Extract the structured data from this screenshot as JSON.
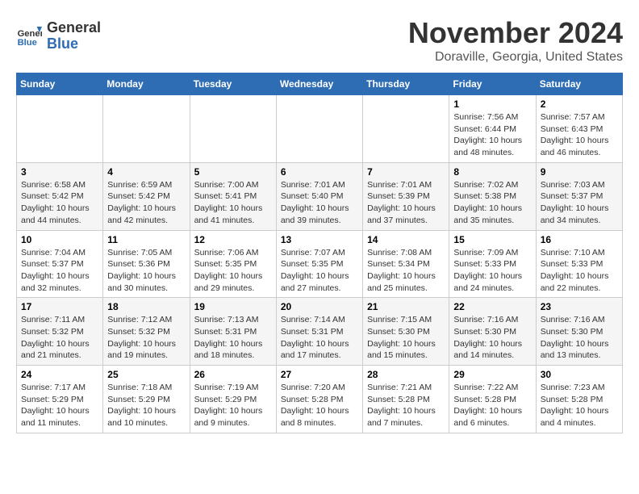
{
  "logo": {
    "general": "General",
    "blue": "Blue"
  },
  "header": {
    "month_title": "November 2024",
    "location": "Doraville, Georgia, United States"
  },
  "weekdays": [
    "Sunday",
    "Monday",
    "Tuesday",
    "Wednesday",
    "Thursday",
    "Friday",
    "Saturday"
  ],
  "weeks": [
    [
      {
        "day": "",
        "info": ""
      },
      {
        "day": "",
        "info": ""
      },
      {
        "day": "",
        "info": ""
      },
      {
        "day": "",
        "info": ""
      },
      {
        "day": "",
        "info": ""
      },
      {
        "day": "1",
        "info": "Sunrise: 7:56 AM\nSunset: 6:44 PM\nDaylight: 10 hours and 48 minutes."
      },
      {
        "day": "2",
        "info": "Sunrise: 7:57 AM\nSunset: 6:43 PM\nDaylight: 10 hours and 46 minutes."
      }
    ],
    [
      {
        "day": "3",
        "info": "Sunrise: 6:58 AM\nSunset: 5:42 PM\nDaylight: 10 hours and 44 minutes."
      },
      {
        "day": "4",
        "info": "Sunrise: 6:59 AM\nSunset: 5:42 PM\nDaylight: 10 hours and 42 minutes."
      },
      {
        "day": "5",
        "info": "Sunrise: 7:00 AM\nSunset: 5:41 PM\nDaylight: 10 hours and 41 minutes."
      },
      {
        "day": "6",
        "info": "Sunrise: 7:01 AM\nSunset: 5:40 PM\nDaylight: 10 hours and 39 minutes."
      },
      {
        "day": "7",
        "info": "Sunrise: 7:01 AM\nSunset: 5:39 PM\nDaylight: 10 hours and 37 minutes."
      },
      {
        "day": "8",
        "info": "Sunrise: 7:02 AM\nSunset: 5:38 PM\nDaylight: 10 hours and 35 minutes."
      },
      {
        "day": "9",
        "info": "Sunrise: 7:03 AM\nSunset: 5:37 PM\nDaylight: 10 hours and 34 minutes."
      }
    ],
    [
      {
        "day": "10",
        "info": "Sunrise: 7:04 AM\nSunset: 5:37 PM\nDaylight: 10 hours and 32 minutes."
      },
      {
        "day": "11",
        "info": "Sunrise: 7:05 AM\nSunset: 5:36 PM\nDaylight: 10 hours and 30 minutes."
      },
      {
        "day": "12",
        "info": "Sunrise: 7:06 AM\nSunset: 5:35 PM\nDaylight: 10 hours and 29 minutes."
      },
      {
        "day": "13",
        "info": "Sunrise: 7:07 AM\nSunset: 5:35 PM\nDaylight: 10 hours and 27 minutes."
      },
      {
        "day": "14",
        "info": "Sunrise: 7:08 AM\nSunset: 5:34 PM\nDaylight: 10 hours and 25 minutes."
      },
      {
        "day": "15",
        "info": "Sunrise: 7:09 AM\nSunset: 5:33 PM\nDaylight: 10 hours and 24 minutes."
      },
      {
        "day": "16",
        "info": "Sunrise: 7:10 AM\nSunset: 5:33 PM\nDaylight: 10 hours and 22 minutes."
      }
    ],
    [
      {
        "day": "17",
        "info": "Sunrise: 7:11 AM\nSunset: 5:32 PM\nDaylight: 10 hours and 21 minutes."
      },
      {
        "day": "18",
        "info": "Sunrise: 7:12 AM\nSunset: 5:32 PM\nDaylight: 10 hours and 19 minutes."
      },
      {
        "day": "19",
        "info": "Sunrise: 7:13 AM\nSunset: 5:31 PM\nDaylight: 10 hours and 18 minutes."
      },
      {
        "day": "20",
        "info": "Sunrise: 7:14 AM\nSunset: 5:31 PM\nDaylight: 10 hours and 17 minutes."
      },
      {
        "day": "21",
        "info": "Sunrise: 7:15 AM\nSunset: 5:30 PM\nDaylight: 10 hours and 15 minutes."
      },
      {
        "day": "22",
        "info": "Sunrise: 7:16 AM\nSunset: 5:30 PM\nDaylight: 10 hours and 14 minutes."
      },
      {
        "day": "23",
        "info": "Sunrise: 7:16 AM\nSunset: 5:30 PM\nDaylight: 10 hours and 13 minutes."
      }
    ],
    [
      {
        "day": "24",
        "info": "Sunrise: 7:17 AM\nSunset: 5:29 PM\nDaylight: 10 hours and 11 minutes."
      },
      {
        "day": "25",
        "info": "Sunrise: 7:18 AM\nSunset: 5:29 PM\nDaylight: 10 hours and 10 minutes."
      },
      {
        "day": "26",
        "info": "Sunrise: 7:19 AM\nSunset: 5:29 PM\nDaylight: 10 hours and 9 minutes."
      },
      {
        "day": "27",
        "info": "Sunrise: 7:20 AM\nSunset: 5:28 PM\nDaylight: 10 hours and 8 minutes."
      },
      {
        "day": "28",
        "info": "Sunrise: 7:21 AM\nSunset: 5:28 PM\nDaylight: 10 hours and 7 minutes."
      },
      {
        "day": "29",
        "info": "Sunrise: 7:22 AM\nSunset: 5:28 PM\nDaylight: 10 hours and 6 minutes."
      },
      {
        "day": "30",
        "info": "Sunrise: 7:23 AM\nSunset: 5:28 PM\nDaylight: 10 hours and 4 minutes."
      }
    ]
  ]
}
